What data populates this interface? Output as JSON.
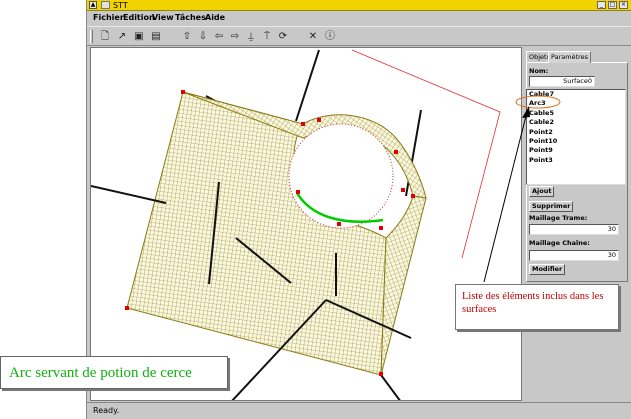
{
  "window": {
    "title": "STT",
    "menu": [
      "Fichier",
      "Edition",
      "View",
      "Tâches",
      "Aide"
    ],
    "toolbar_icons": [
      "new-file-icon",
      "open-icon",
      "save-icon",
      "save-as-icon",
      "arrow-up-icon",
      "arrow-down-icon",
      "arrow-left-icon",
      "arrow-right-icon",
      "anchor-up-icon",
      "anchor-down-icon",
      "refresh-icon",
      "delete-icon",
      "info-icon"
    ]
  },
  "panel": {
    "tabs": [
      "Objets",
      "Paramètres"
    ],
    "name_label": "Nom:",
    "name_value": "Surface0",
    "elements": [
      "Cable7",
      "Arc3",
      "Cable5",
      "Cable2",
      "Point2",
      "Point10",
      "Point9",
      "Point3"
    ],
    "add_button": "Ajout",
    "remove_button": "Supprimer",
    "weft_label": "Maillage Trame:",
    "weft_value": "30",
    "warp_label": "Maillage Chaîne:",
    "warp_value": "30",
    "modify_button": "Modifier"
  },
  "status": "Ready.",
  "annotations": {
    "list_note": "Liste des éléments inclus dans les surfaces",
    "arc_note": "Arc servant de potion de cerce"
  },
  "colors": {
    "titlebar": "#f2d200",
    "mesh": "#8a7a10",
    "arc": "#00cc00",
    "annotation_list": "#c00000",
    "annotation_arc": "#10b010"
  }
}
